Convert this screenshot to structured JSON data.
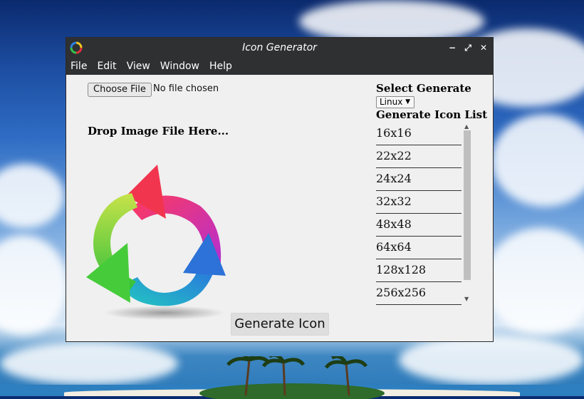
{
  "window": {
    "title": "Icon Generator",
    "controls": {
      "minimize": "−",
      "maximize": "⤢",
      "close": "✕"
    }
  },
  "menu": [
    "File",
    "Edit",
    "View",
    "Window",
    "Help"
  ],
  "file_input": {
    "button_label": "Choose File",
    "status": "No file chosen"
  },
  "drop_area": {
    "label": "Drop Image File Here...",
    "image_icon": "refresh-arrows-icon"
  },
  "generate_select": {
    "label": "Select Generate",
    "selected": "Linux"
  },
  "icon_list": {
    "label": "Generate Icon List",
    "items": [
      "16x16",
      "22x22",
      "24x24",
      "32x32",
      "48x48",
      "64x64",
      "128x128",
      "256x256"
    ]
  },
  "generate_button": {
    "label": "Generate Icon"
  },
  "colors": {
    "titlebar": "#2f3032",
    "window_bg": "#f0f0f0"
  }
}
